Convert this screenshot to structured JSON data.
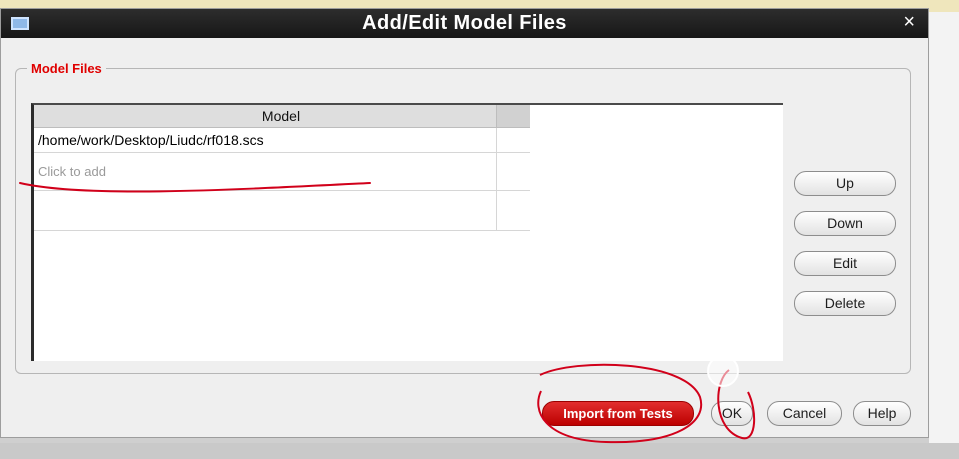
{
  "dialog": {
    "title": "Add/Edit Model Files",
    "close_label": "×"
  },
  "group": {
    "label": "Model Files"
  },
  "table": {
    "header": "Model",
    "rows": [
      "/home/work/Desktop/Liudc/rf018.scs",
      "Click to add"
    ]
  },
  "side_buttons": {
    "up": "Up",
    "down": "Down",
    "edit": "Edit",
    "delete": "Delete"
  },
  "footer_buttons": {
    "import": "Import from Tests",
    "ok": "OK",
    "cancel": "Cancel",
    "help": "Help"
  },
  "colors": {
    "accent_red": "#e00000",
    "title_bar": "#1f1f1f",
    "dialog_bg": "#efefef"
  }
}
